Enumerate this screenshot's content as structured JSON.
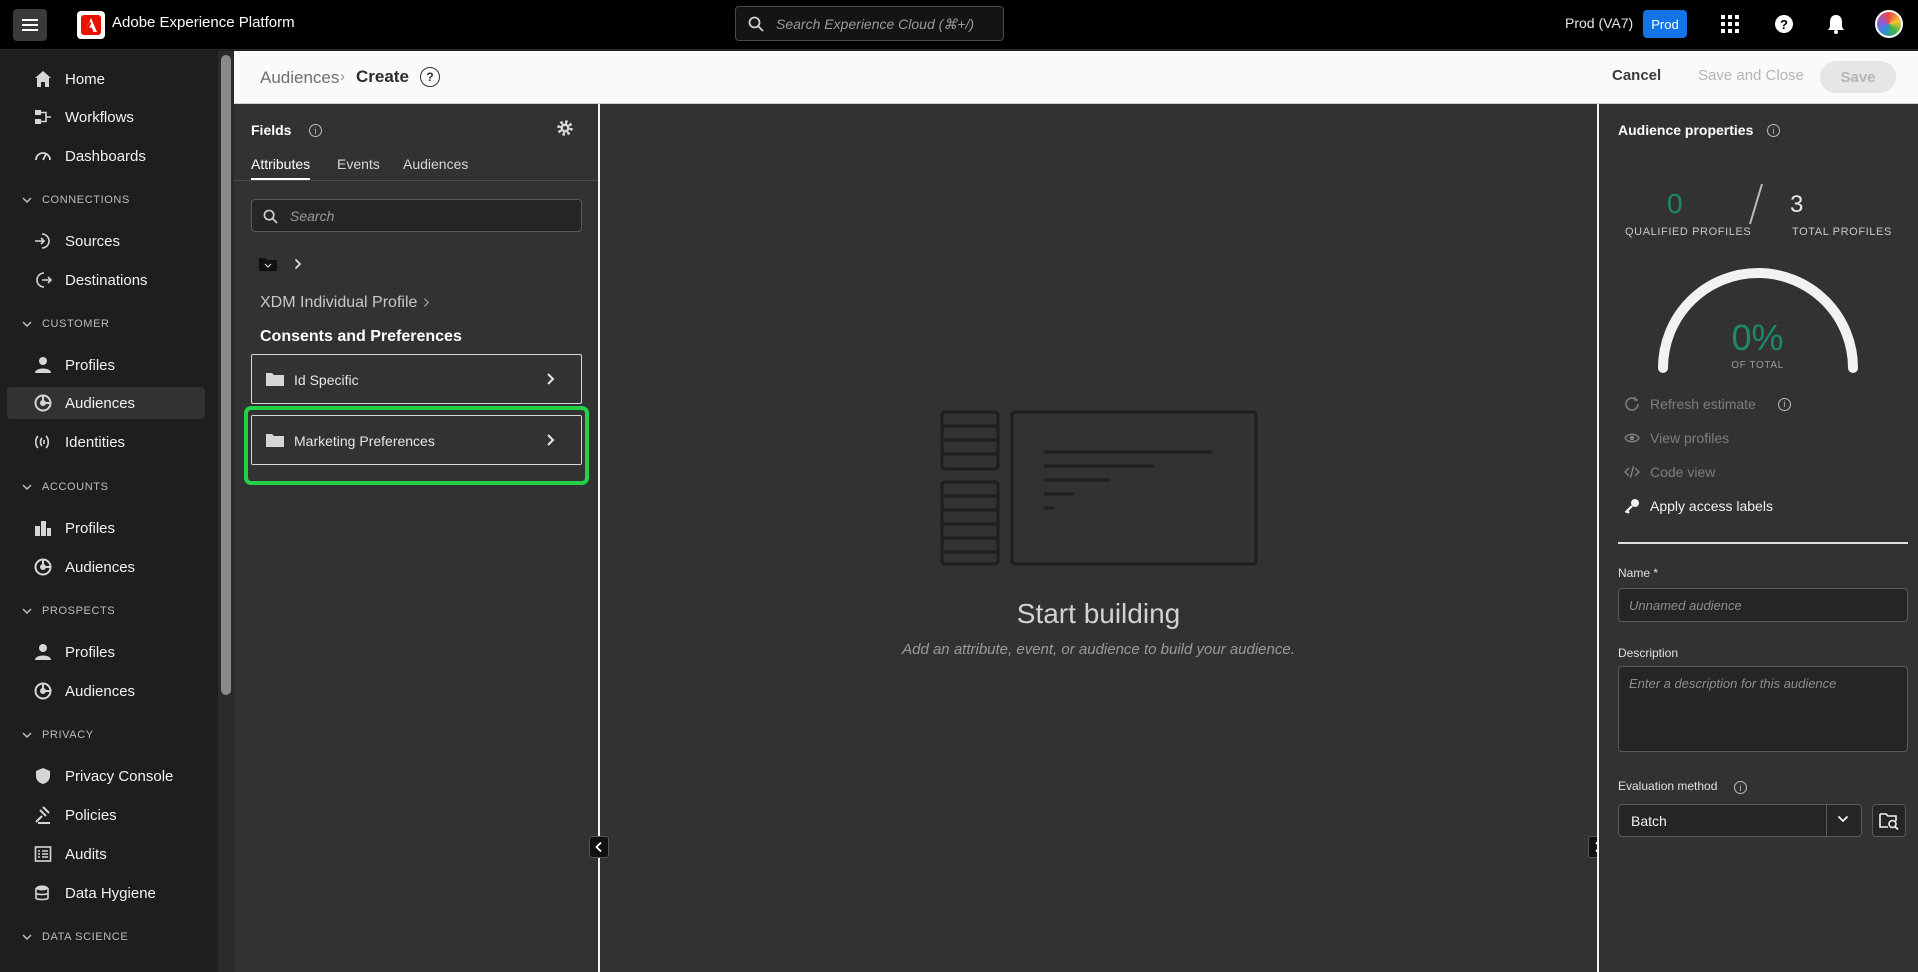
{
  "topbar": {
    "app_title": "Adobe Experience Platform",
    "search_placeholder": "Search Experience Cloud (⌘+/)",
    "sandbox": "Prod (VA7)",
    "env_badge": "Prod"
  },
  "sidebar": {
    "items": [
      {
        "label": "Home",
        "icon": "home-icon"
      },
      {
        "label": "Workflows",
        "icon": "workflows-icon"
      },
      {
        "label": "Dashboards",
        "icon": "dashboards-icon"
      },
      {
        "label": "Sources",
        "icon": "sources-icon"
      },
      {
        "label": "Destinations",
        "icon": "destinations-icon"
      },
      {
        "label": "Profiles",
        "icon": "profile-icon"
      },
      {
        "label": "Audiences",
        "icon": "audiences-icon",
        "active": true
      },
      {
        "label": "Identities",
        "icon": "identities-icon"
      },
      {
        "label": "Profiles",
        "icon": "account-profiles-icon"
      },
      {
        "label": "Audiences",
        "icon": "audiences-icon"
      },
      {
        "label": "Profiles",
        "icon": "profile-icon"
      },
      {
        "label": "Audiences",
        "icon": "audiences-icon"
      },
      {
        "label": "Privacy Console",
        "icon": "privacy-icon"
      },
      {
        "label": "Policies",
        "icon": "policies-icon"
      },
      {
        "label": "Audits",
        "icon": "audits-icon"
      },
      {
        "label": "Data Hygiene",
        "icon": "data-hygiene-icon"
      }
    ],
    "sections": [
      "CONNECTIONS",
      "CUSTOMER",
      "ACCOUNTS",
      "PROSPECTS",
      "PRIVACY",
      "DATA SCIENCE"
    ]
  },
  "header": {
    "breadcrumb_parent": "Audiences",
    "breadcrumb_sep": "›",
    "breadcrumb_current": "Create",
    "cancel_label": "Cancel",
    "save_close_label": "Save and Close",
    "save_label": "Save"
  },
  "fields_panel": {
    "title": "Fields",
    "tabs": [
      "Attributes",
      "Events",
      "Audiences"
    ],
    "active_tab": "Attributes",
    "search_placeholder": "Search",
    "path_root": "XDM Individual Profile",
    "current_section": "Consents and Preferences",
    "folders": [
      {
        "label": "Id Specific"
      },
      {
        "label": "Marketing Preferences",
        "highlighted": true
      }
    ]
  },
  "canvas": {
    "title": "Start building",
    "subtitle": "Add an attribute, event, or audience to build your audience."
  },
  "properties": {
    "title": "Audience properties",
    "qualified_value": "0",
    "qualified_label": "QUALIFIED PROFILES",
    "total_value": "3",
    "total_label": "TOTAL PROFILES",
    "percent": "0%",
    "percent_label": "OF TOTAL",
    "actions": [
      {
        "label": "Refresh estimate",
        "enabled": false
      },
      {
        "label": "View profiles",
        "enabled": false
      },
      {
        "label": "Code view",
        "enabled": false
      },
      {
        "label": "Apply access labels",
        "enabled": true
      }
    ],
    "name_label": "Name *",
    "name_placeholder": "Unnamed audience",
    "description_label": "Description",
    "description_placeholder": "Enter a description for this audience",
    "evaluation_label": "Evaluation method",
    "evaluation_value": "Batch"
  },
  "colors": {
    "accent_blue": "#1473e6",
    "highlight_green": "#25d049",
    "teal_value": "#1c8a6a"
  }
}
